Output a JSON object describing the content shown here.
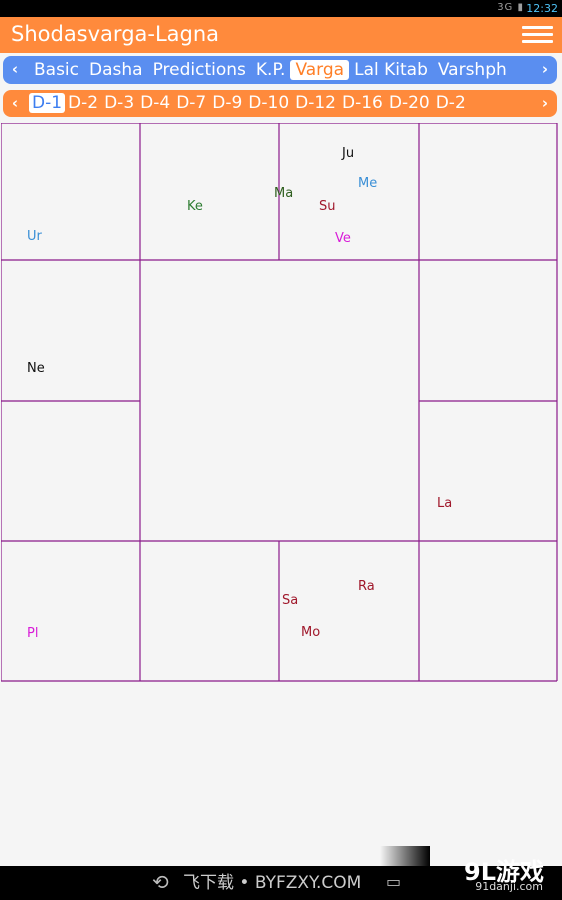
{
  "status_bar": {
    "signal": "3G",
    "time": "12:32"
  },
  "app_bar": {
    "title": "Shodasvarga-Lagna"
  },
  "tabs": {
    "items": [
      "Basic",
      "Dasha",
      "Predictions",
      "K.P.",
      "Varga",
      "Lal Kitab",
      "Varshph"
    ],
    "active": "Varga"
  },
  "varga_tabs": {
    "items": [
      "D-1",
      "D-2",
      "D-3",
      "D-4",
      "D-7",
      "D-9",
      "D-10",
      "D-12",
      "D-16",
      "D-20",
      "D-2"
    ],
    "active": "D-1"
  },
  "chart": {
    "line_color": "#8b1a8b",
    "planets": [
      {
        "name": "Ur",
        "color": "#3a8fd6",
        "house": "row0-col0"
      },
      {
        "name": "Ke",
        "color": "#2e7d32",
        "house": "row0-col1"
      },
      {
        "name": "Ma",
        "color": "#2e5e1e",
        "house": "row0-col2"
      },
      {
        "name": "Ju",
        "color": "#111111",
        "house": "row0-col2"
      },
      {
        "name": "Me",
        "color": "#3a8fd6",
        "house": "row0-col2"
      },
      {
        "name": "Su",
        "color": "#a0182b",
        "house": "row0-col2"
      },
      {
        "name": "Ve",
        "color": "#d81bd8",
        "house": "row0-col2"
      },
      {
        "name": "Ne",
        "color": "#111111",
        "house": "row1-col0"
      },
      {
        "name": "La",
        "color": "#a0182b",
        "house": "row2-col3"
      },
      {
        "name": "Pl",
        "color": "#d81bd8",
        "house": "row3-col0"
      },
      {
        "name": "Sa",
        "color": "#a0182b",
        "house": "row3-col2"
      },
      {
        "name": "Ra",
        "color": "#a0182b",
        "house": "row3-col2"
      },
      {
        "name": "Mo",
        "color": "#a0182b",
        "house": "row3-col2"
      }
    ]
  },
  "watermark": {
    "text": "飞下载 • BYFZXY.COM",
    "logo": "9L游戏",
    "site": "91danji.com"
  },
  "nav_icons": [
    "back-icon",
    "home-icon",
    "recents-icon"
  ]
}
